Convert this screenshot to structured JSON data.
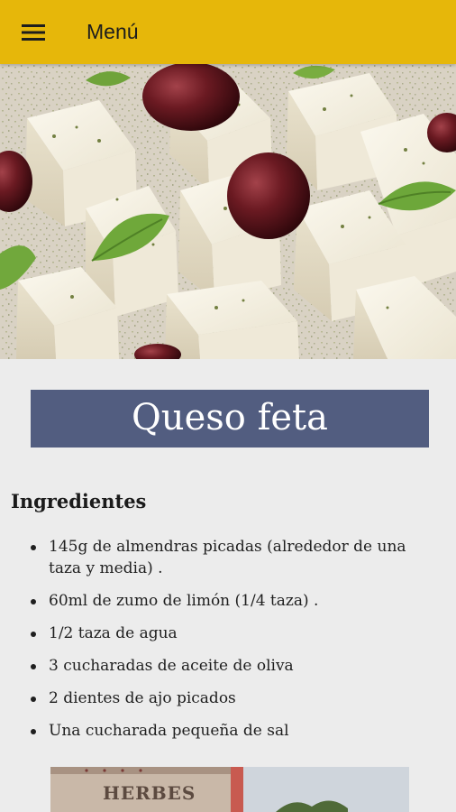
{
  "app_bar": {
    "menu_icon": "hamburger-menu-icon",
    "title": "Menú",
    "color": "#e6b70a"
  },
  "hero_image": {
    "subject": "feta-cheese-cubes-with-olives-and-basil"
  },
  "recipe": {
    "title": "Queso feta",
    "title_banner_color": "#525d80",
    "ingredients_heading": "Ingredientes",
    "ingredients": [
      "145g de almendras picadas (alrededor de una taza y media) .",
      "60ml de zumo de limón (1/4 taza) .",
      "1/2 taza de agua",
      "3 cucharadas de aceite de oliva",
      "2 dientes de ajo picados",
      "Una cucharada pequeña de sal"
    ]
  },
  "bottom_image": {
    "label_text": "HERBES"
  }
}
